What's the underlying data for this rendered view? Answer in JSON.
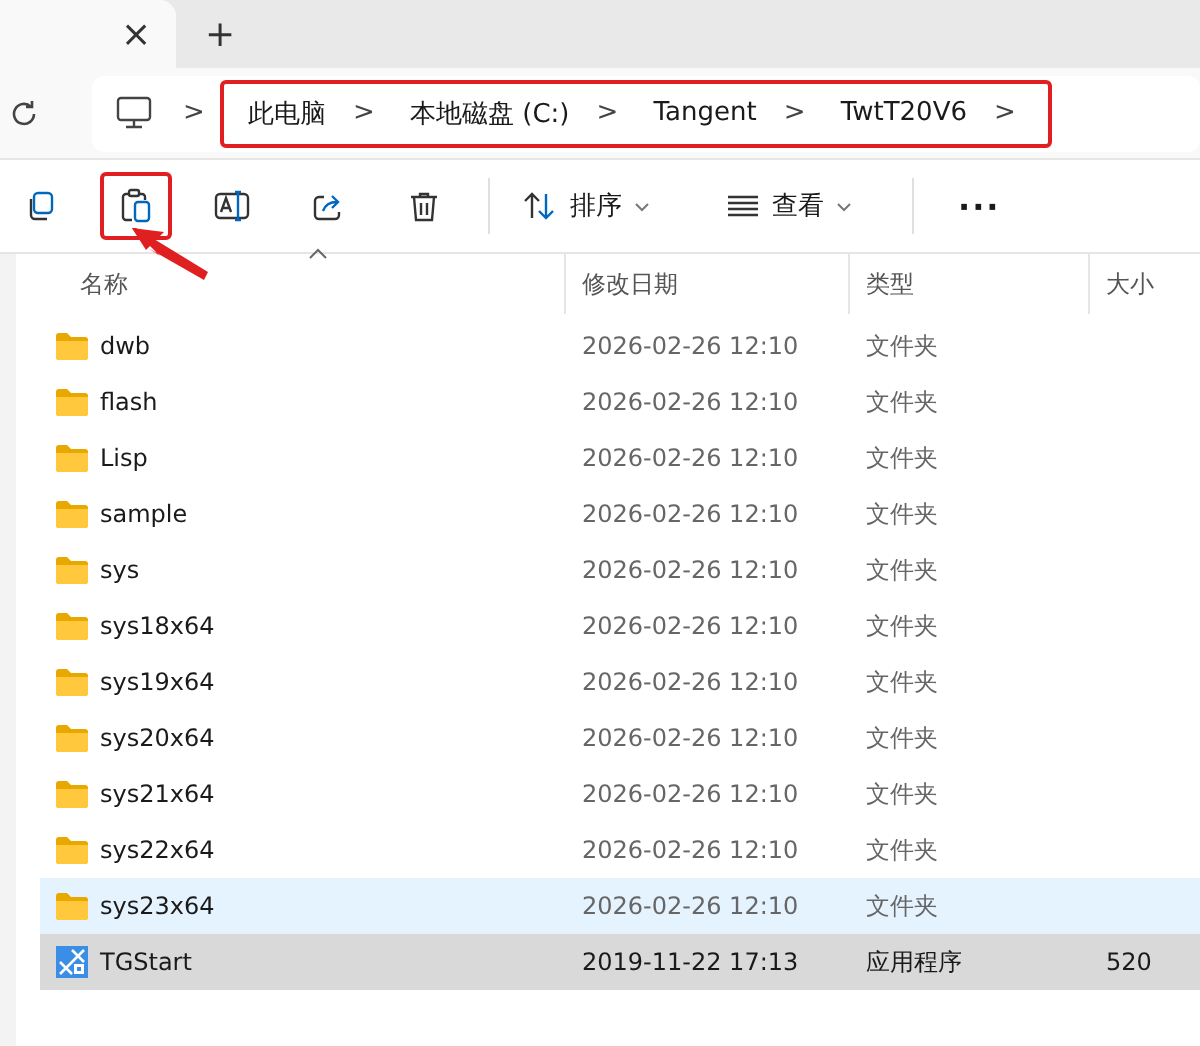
{
  "tabs": {
    "close": "×",
    "new_tab": "+"
  },
  "address": {
    "highlighted": true,
    "crumbs": [
      "此电脑",
      "本地磁盘 (C:)",
      "Tangent",
      "TwtT20V6"
    ],
    "separator": ">"
  },
  "toolbar": {
    "items": [
      {
        "kind": "copy",
        "highlighted": false
      },
      {
        "kind": "paste",
        "highlighted": true
      },
      {
        "kind": "rename",
        "highlighted": false
      },
      {
        "kind": "share",
        "highlighted": false
      },
      {
        "kind": "delete",
        "highlighted": false
      },
      {
        "kind": "divider"
      },
      {
        "kind": "sort",
        "label": "排序"
      },
      {
        "kind": "view",
        "label": "查看"
      },
      {
        "kind": "divider"
      },
      {
        "kind": "more",
        "label": "···"
      }
    ],
    "arrow": true
  },
  "table": {
    "columns": [
      "名称",
      "修改日期",
      "类型",
      "大小"
    ],
    "rows": [
      {
        "kind": "folder",
        "name": "dwb",
        "date": "2026-02-26 12:10",
        "type": "文件夹",
        "hovered": false,
        "selected": false
      },
      {
        "kind": "folder",
        "name": "flash",
        "date": "2026-02-26 12:10",
        "type": "文件夹",
        "hovered": false,
        "selected": false
      },
      {
        "kind": "folder",
        "name": "Lisp",
        "date": "2026-02-26 12:10",
        "type": "文件夹",
        "hovered": false,
        "selected": false
      },
      {
        "kind": "folder",
        "name": "sample",
        "date": "2026-02-26 12:10",
        "type": "文件夹",
        "hovered": false,
        "selected": false
      },
      {
        "kind": "folder",
        "name": "sys",
        "date": "2026-02-26 12:10",
        "type": "文件夹",
        "hovered": false,
        "selected": false
      },
      {
        "kind": "folder",
        "name": "sys18x64",
        "date": "2026-02-26 12:10",
        "type": "文件夹",
        "hovered": false,
        "selected": false
      },
      {
        "kind": "folder",
        "name": "sys19x64",
        "date": "2026-02-26 12:10",
        "type": "文件夹",
        "hovered": false,
        "selected": false
      },
      {
        "kind": "folder",
        "name": "sys20x64",
        "date": "2026-02-26 12:10",
        "type": "文件夹",
        "hovered": false,
        "selected": false
      },
      {
        "kind": "folder",
        "name": "sys21x64",
        "date": "2026-02-26 12:10",
        "type": "文件夹",
        "hovered": false,
        "selected": false
      },
      {
        "kind": "folder",
        "name": "sys22x64",
        "date": "2026-02-26 12:10",
        "type": "文件夹",
        "hovered": false,
        "selected": false
      },
      {
        "kind": "folder",
        "name": "sys23x64",
        "date": "2026-02-26 12:10",
        "type": "文件夹",
        "hovered": true,
        "selected": false
      },
      {
        "kind": "app",
        "name": "TGStart",
        "date": "2019-11-22 17:13",
        "type": "应用程序",
        "size": "520",
        "hovered": false,
        "selected": true
      }
    ]
  }
}
